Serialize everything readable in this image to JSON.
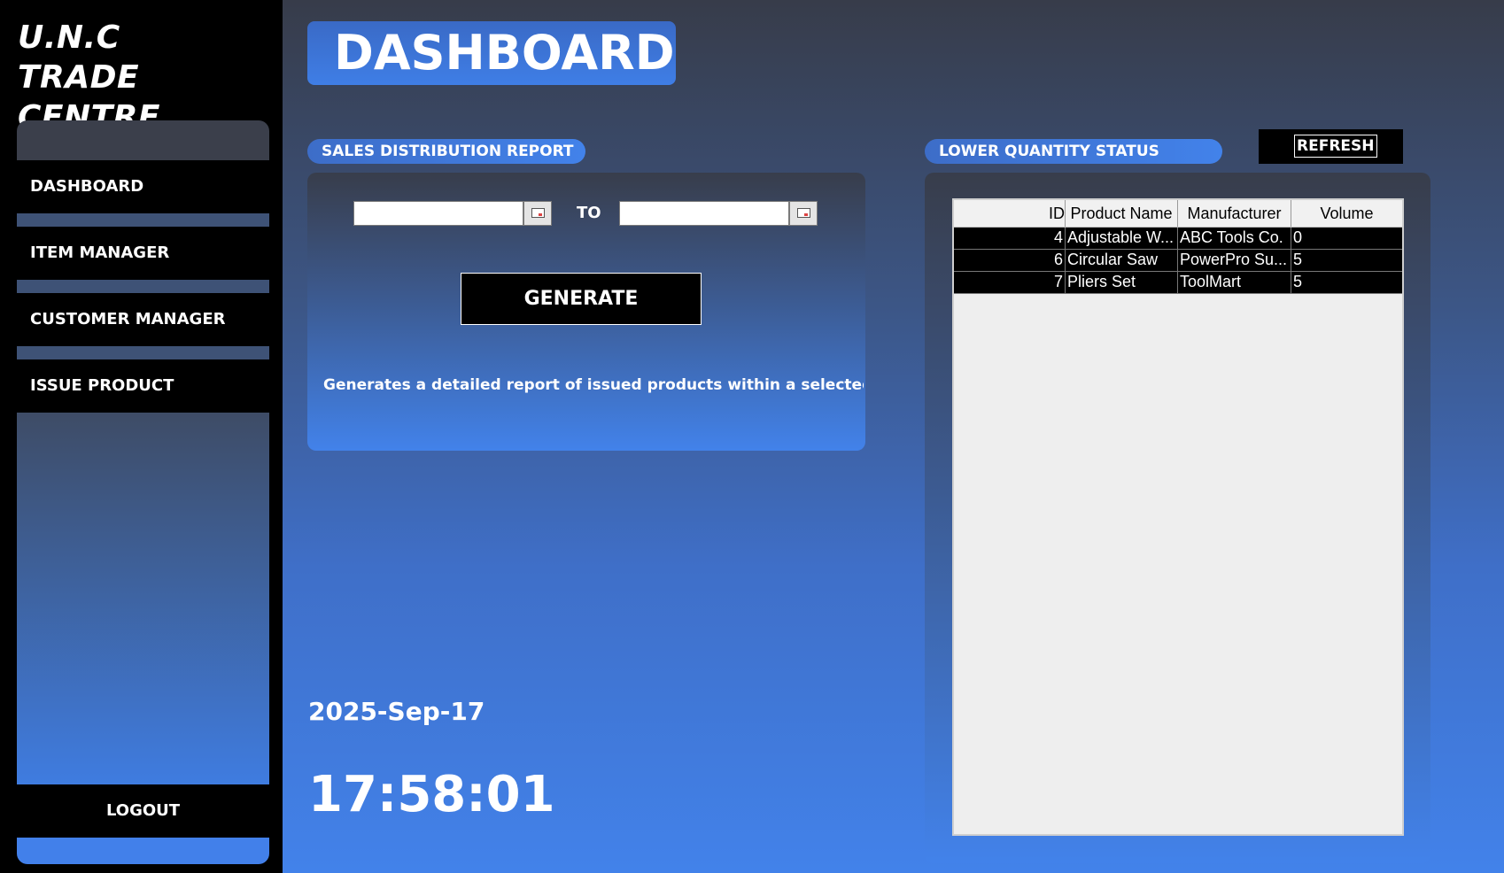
{
  "brand": {
    "line1": "U.N.C",
    "line2": "TRADE CENTRE"
  },
  "sidebar": {
    "items": [
      {
        "label": "DASHBOARD"
      },
      {
        "label": "ITEM MANAGER"
      },
      {
        "label": "CUSTOMER MANAGER"
      },
      {
        "label": "ISSUE PRODUCT"
      }
    ],
    "logout": "LOGOUT"
  },
  "main": {
    "title": "DASHBOARD"
  },
  "sales": {
    "label": "SALES DISTRIBUTION REPORT",
    "from_value": "",
    "to_label": "TO",
    "to_value": "",
    "generate": "GENERATE",
    "description": "Generates a detailed report of issued products within a selected date r"
  },
  "clock": {
    "date": "2025-Sep-17",
    "time": "17:58:01"
  },
  "lower_qty": {
    "label": "LOWER QUANTITY STATUS",
    "refresh": "REFRESH",
    "columns": [
      "ID",
      "Product Name",
      "Manufacturer",
      "Volume"
    ],
    "rows": [
      [
        "4",
        "Adjustable W...",
        "ABC Tools Co.",
        "0"
      ],
      [
        "6",
        "Circular Saw",
        "PowerPro Su...",
        "5"
      ],
      [
        "7",
        "Pliers Set",
        "ToolMart",
        "5"
      ]
    ]
  }
}
